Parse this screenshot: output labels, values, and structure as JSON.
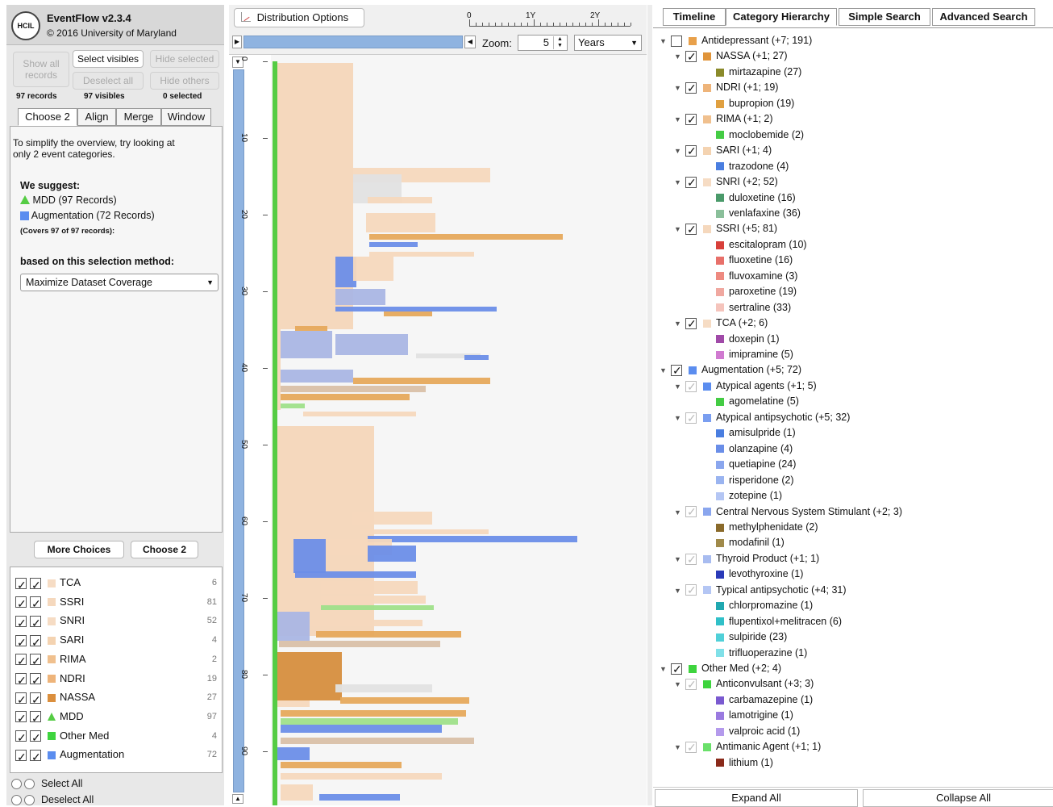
{
  "app": {
    "title": "EventFlow v2.3.4",
    "copyright": "© 2016 University of Maryland",
    "logo_text": "HCIL"
  },
  "record_buttons": {
    "show_all": "Show all records",
    "select_visibles": "Select visibles",
    "hide_selected": "Hide selected",
    "deselect_all": "Deselect all",
    "hide_others": "Hide others"
  },
  "stats": {
    "records": "97 records",
    "visibles": "97 visibles",
    "selected": "0 selected"
  },
  "left_tabs": [
    "Choose 2",
    "Align",
    "Merge",
    "Window"
  ],
  "panel": {
    "intro": "To simplify the overview, try looking at only 2 event categories.",
    "suggest_heading": "We suggest:",
    "suggestion_1": "MDD (97 Records)",
    "suggestion_2": "Augmentation (72 Records)",
    "covers": "(Covers 97 of 97 records):",
    "method_heading": "based on this selection method:",
    "method_value": "Maximize Dataset Coverage"
  },
  "choice_buttons": {
    "more": "More Choices",
    "choose2": "Choose 2"
  },
  "legend": [
    {
      "label": "TCA",
      "count": "6",
      "color": "#f6dcc4",
      "shape": "square"
    },
    {
      "label": "SSRI",
      "count": "81",
      "color": "#f5d8bd",
      "shape": "square"
    },
    {
      "label": "SNRI",
      "count": "52",
      "color": "#f6dcc4",
      "shape": "square"
    },
    {
      "label": "SARI",
      "count": "4",
      "color": "#f4d3b1",
      "shape": "square"
    },
    {
      "label": "RIMA",
      "count": "2",
      "color": "#f0c08e",
      "shape": "square"
    },
    {
      "label": "NDRI",
      "count": "19",
      "color": "#eeb47a",
      "shape": "square"
    },
    {
      "label": "NASSA",
      "count": "27",
      "color": "#db8f3d",
      "shape": "square"
    },
    {
      "label": "MDD",
      "count": "97",
      "color": "#55cc44",
      "shape": "triangle"
    },
    {
      "label": "Other Med",
      "count": "4",
      "color": "#3ed43e",
      "shape": "square"
    },
    {
      "label": "Augmentation",
      "count": "72",
      "color": "#5b8def",
      "shape": "square"
    }
  ],
  "select_all": "Select All",
  "deselect_all_bottom": "Deselect All",
  "mid": {
    "dist_button": "Distribution Options",
    "ruler_labels": [
      "0",
      "1Y",
      "2Y"
    ],
    "zoom_label": "Zoom:",
    "zoom_value": "5",
    "unit_value": "Years",
    "y_ticks": [
      "0",
      "10",
      "20",
      "30",
      "40",
      "50",
      "60",
      "70",
      "80",
      "90"
    ]
  },
  "right_tabs": [
    "Timeline",
    "Category Hierarchy",
    "Simple Search",
    "Advanced Search"
  ],
  "tree": [
    {
      "level": 0,
      "label": "Antidepressant (+7; 191)",
      "color": "#e8a04a",
      "checked": false,
      "gray": false,
      "expand": true
    },
    {
      "level": 1,
      "label": "NASSA (+1; 27)",
      "color": "#e0943a",
      "checked": true,
      "gray": false,
      "expand": true
    },
    {
      "level": 2,
      "label": "mirtazapine (27)",
      "color": "#8a8a2a"
    },
    {
      "level": 1,
      "label": "NDRI (+1; 19)",
      "color": "#eeb47a",
      "checked": true,
      "gray": false,
      "expand": true
    },
    {
      "level": 2,
      "label": "bupropion (19)",
      "color": "#e0a040"
    },
    {
      "level": 1,
      "label": "RIMA (+1; 2)",
      "color": "#f0c08e",
      "checked": true,
      "gray": false,
      "expand": true
    },
    {
      "level": 2,
      "label": "moclobemide (2)",
      "color": "#44cc44"
    },
    {
      "level": 1,
      "label": "SARI (+1; 4)",
      "color": "#f4d3b1",
      "checked": true,
      "gray": false,
      "expand": true
    },
    {
      "level": 2,
      "label": "trazodone (4)",
      "color": "#4a7ee0"
    },
    {
      "level": 1,
      "label": "SNRI (+2; 52)",
      "color": "#f6dcc4",
      "checked": true,
      "gray": false,
      "expand": true
    },
    {
      "level": 2,
      "label": "duloxetine (16)",
      "color": "#4a9a6a"
    },
    {
      "level": 2,
      "label": "venlafaxine (36)",
      "color": "#8abf9a"
    },
    {
      "level": 1,
      "label": "SSRI (+5; 81)",
      "color": "#f5d8bd",
      "checked": true,
      "gray": false,
      "expand": true
    },
    {
      "level": 2,
      "label": "escitalopram (10)",
      "color": "#d8403a"
    },
    {
      "level": 2,
      "label": "fluoxetine (16)",
      "color": "#e8706a"
    },
    {
      "level": 2,
      "label": "fluvoxamine (3)",
      "color": "#ee8a80"
    },
    {
      "level": 2,
      "label": "paroxetine (19)",
      "color": "#f0a8a0"
    },
    {
      "level": 2,
      "label": "sertraline (33)",
      "color": "#f5c4bc"
    },
    {
      "level": 1,
      "label": "TCA (+2; 6)",
      "color": "#f6dcc4",
      "checked": true,
      "gray": false,
      "expand": true
    },
    {
      "level": 2,
      "label": "doxepin (1)",
      "color": "#a04aa8"
    },
    {
      "level": 2,
      "label": "imipramine (5)",
      "color": "#d07ad0"
    },
    {
      "level": 0,
      "label": "Augmentation (+5; 72)",
      "color": "#5b8def",
      "checked": true,
      "gray": false,
      "expand": true
    },
    {
      "level": 1,
      "label": "Atypical agents (+1; 5)",
      "color": "#5b8def",
      "checked": true,
      "gray": true,
      "expand": true
    },
    {
      "level": 2,
      "label": "agomelatine (5)",
      "color": "#44cc44"
    },
    {
      "level": 1,
      "label": "Atypical antipsychotic (+5; 32)",
      "color": "#7a9ef0",
      "checked": true,
      "gray": true,
      "expand": true
    },
    {
      "level": 2,
      "label": "amisulpride (1)",
      "color": "#4a7ee0"
    },
    {
      "level": 2,
      "label": "olanzapine (4)",
      "color": "#6a8ee8"
    },
    {
      "level": 2,
      "label": "quetiapine (24)",
      "color": "#8aa6ee"
    },
    {
      "level": 2,
      "label": "risperidone (2)",
      "color": "#9ab4f0"
    },
    {
      "level": 2,
      "label": "zotepine (1)",
      "color": "#b4c6f4"
    },
    {
      "level": 1,
      "label": "Central Nervous System Stimulant (+2; 3)",
      "color": "#8aa6ee",
      "checked": true,
      "gray": true,
      "expand": true
    },
    {
      "level": 2,
      "label": "methylphenidate (2)",
      "color": "#8a6a2a"
    },
    {
      "level": 2,
      "label": "modafinil (1)",
      "color": "#a08a4a"
    },
    {
      "level": 1,
      "label": "Thyroid Product (+1; 1)",
      "color": "#a8bcf0",
      "checked": true,
      "gray": true,
      "expand": true
    },
    {
      "level": 2,
      "label": "levothyroxine (1)",
      "color": "#2a3ab8"
    },
    {
      "level": 1,
      "label": "Typical antipsychotic (+4; 31)",
      "color": "#b4c6f4",
      "checked": true,
      "gray": true,
      "expand": true
    },
    {
      "level": 2,
      "label": "chlorpromazine (1)",
      "color": "#20a8b0"
    },
    {
      "level": 2,
      "label": "flupentixol+melitracen (6)",
      "color": "#30c0c8"
    },
    {
      "level": 2,
      "label": "sulpiride (23)",
      "color": "#50d0d8"
    },
    {
      "level": 2,
      "label": "trifluoperazine (1)",
      "color": "#80e0e8"
    },
    {
      "level": 0,
      "label": "Other Med (+2; 4)",
      "color": "#3ed43e",
      "checked": true,
      "gray": false,
      "expand": true
    },
    {
      "level": 1,
      "label": "Anticonvulsant (+3; 3)",
      "color": "#3ed43e",
      "checked": true,
      "gray": true,
      "expand": true
    },
    {
      "level": 2,
      "label": "carbamazepine (1)",
      "color": "#7a5ad0"
    },
    {
      "level": 2,
      "label": "lamotrigine (1)",
      "color": "#9a7ae0"
    },
    {
      "level": 2,
      "label": "valproic acid (1)",
      "color": "#b49aec"
    },
    {
      "level": 1,
      "label": "Antimanic Agent (+1; 1)",
      "color": "#6ae06a",
      "checked": true,
      "gray": true,
      "expand": true
    },
    {
      "level": 2,
      "label": "lithium (1)",
      "color": "#8a2a1a"
    }
  ],
  "tree_buttons": {
    "expand": "Expand All",
    "collapse": "Collapse All"
  }
}
